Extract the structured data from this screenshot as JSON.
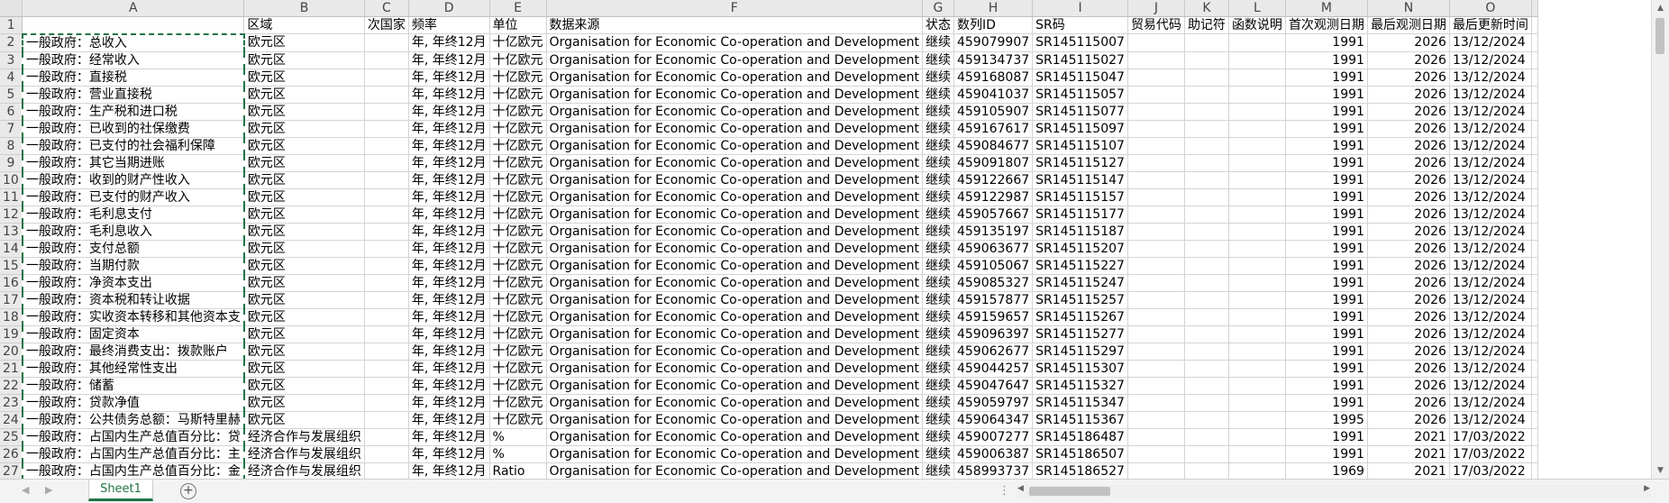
{
  "columns": [
    "A",
    "B",
    "C",
    "D",
    "E",
    "F",
    "G",
    "H",
    "I",
    "J",
    "K",
    "L",
    "M",
    "N",
    "O"
  ],
  "headers": [
    "",
    "区域",
    "次国家",
    "频率",
    "单位",
    "数据来源",
    "状态",
    "数列ID",
    "SR码",
    "贸易代码",
    "助记符",
    "函数说明",
    "首次观测日期",
    "最后观测日期",
    "最后更新时间"
  ],
  "rows": [
    {
      "n": "2",
      "a": "一般政府：总收入",
      "b": "欧元区",
      "c": "",
      "d": "年, 年终12月",
      "e": "十亿欧元",
      "f": "Organisation for Economic Co-operation and Development",
      "g": "继续",
      "h": "459079907",
      "i": "SR145115007",
      "j": "",
      "k": "",
      "l": "",
      "m": "1991",
      "nn": "2026",
      "o": "13/12/2024"
    },
    {
      "n": "3",
      "a": "一般政府：经常收入",
      "b": "欧元区",
      "c": "",
      "d": "年, 年终12月",
      "e": "十亿欧元",
      "f": "Organisation for Economic Co-operation and Development",
      "g": "继续",
      "h": "459134737",
      "i": "SR145115027",
      "j": "",
      "k": "",
      "l": "",
      "m": "1991",
      "nn": "2026",
      "o": "13/12/2024"
    },
    {
      "n": "4",
      "a": "一般政府：直接税",
      "b": "欧元区",
      "c": "",
      "d": "年, 年终12月",
      "e": "十亿欧元",
      "f": "Organisation for Economic Co-operation and Development",
      "g": "继续",
      "h": "459168087",
      "i": "SR145115047",
      "j": "",
      "k": "",
      "l": "",
      "m": "1991",
      "nn": "2026",
      "o": "13/12/2024"
    },
    {
      "n": "5",
      "a": "一般政府：营业直接税",
      "b": "欧元区",
      "c": "",
      "d": "年, 年终12月",
      "e": "十亿欧元",
      "f": "Organisation for Economic Co-operation and Development",
      "g": "继续",
      "h": "459041037",
      "i": "SR145115057",
      "j": "",
      "k": "",
      "l": "",
      "m": "1991",
      "nn": "2026",
      "o": "13/12/2024"
    },
    {
      "n": "6",
      "a": "一般政府：生产税和进口税",
      "b": "欧元区",
      "c": "",
      "d": "年, 年终12月",
      "e": "十亿欧元",
      "f": "Organisation for Economic Co-operation and Development",
      "g": "继续",
      "h": "459105907",
      "i": "SR145115077",
      "j": "",
      "k": "",
      "l": "",
      "m": "1991",
      "nn": "2026",
      "o": "13/12/2024"
    },
    {
      "n": "7",
      "a": "一般政府：已收到的社保缴费",
      "b": "欧元区",
      "c": "",
      "d": "年, 年终12月",
      "e": "十亿欧元",
      "f": "Organisation for Economic Co-operation and Development",
      "g": "继续",
      "h": "459167617",
      "i": "SR145115097",
      "j": "",
      "k": "",
      "l": "",
      "m": "1991",
      "nn": "2026",
      "o": "13/12/2024"
    },
    {
      "n": "8",
      "a": "一般政府：已支付的社会福利保障",
      "b": "欧元区",
      "c": "",
      "d": "年, 年终12月",
      "e": "十亿欧元",
      "f": "Organisation for Economic Co-operation and Development",
      "g": "继续",
      "h": "459084677",
      "i": "SR145115107",
      "j": "",
      "k": "",
      "l": "",
      "m": "1991",
      "nn": "2026",
      "o": "13/12/2024"
    },
    {
      "n": "9",
      "a": "一般政府：其它当期进账",
      "b": "欧元区",
      "c": "",
      "d": "年, 年终12月",
      "e": "十亿欧元",
      "f": "Organisation for Economic Co-operation and Development",
      "g": "继续",
      "h": "459091807",
      "i": "SR145115127",
      "j": "",
      "k": "",
      "l": "",
      "m": "1991",
      "nn": "2026",
      "o": "13/12/2024"
    },
    {
      "n": "10",
      "a": "一般政府：收到的财产性收入",
      "b": "欧元区",
      "c": "",
      "d": "年, 年终12月",
      "e": "十亿欧元",
      "f": "Organisation for Economic Co-operation and Development",
      "g": "继续",
      "h": "459122667",
      "i": "SR145115147",
      "j": "",
      "k": "",
      "l": "",
      "m": "1991",
      "nn": "2026",
      "o": "13/12/2024"
    },
    {
      "n": "11",
      "a": "一般政府：已支付的财产收入",
      "b": "欧元区",
      "c": "",
      "d": "年, 年终12月",
      "e": "十亿欧元",
      "f": "Organisation for Economic Co-operation and Development",
      "g": "继续",
      "h": "459122987",
      "i": "SR145115157",
      "j": "",
      "k": "",
      "l": "",
      "m": "1991",
      "nn": "2026",
      "o": "13/12/2024"
    },
    {
      "n": "12",
      "a": "一般政府：毛利息支付",
      "b": "欧元区",
      "c": "",
      "d": "年, 年终12月",
      "e": "十亿欧元",
      "f": "Organisation for Economic Co-operation and Development",
      "g": "继续",
      "h": "459057667",
      "i": "SR145115177",
      "j": "",
      "k": "",
      "l": "",
      "m": "1991",
      "nn": "2026",
      "o": "13/12/2024"
    },
    {
      "n": "13",
      "a": "一般政府：毛利息收入",
      "b": "欧元区",
      "c": "",
      "d": "年, 年终12月",
      "e": "十亿欧元",
      "f": "Organisation for Economic Co-operation and Development",
      "g": "继续",
      "h": "459135197",
      "i": "SR145115187",
      "j": "",
      "k": "",
      "l": "",
      "m": "1991",
      "nn": "2026",
      "o": "13/12/2024"
    },
    {
      "n": "14",
      "a": "一般政府：支付总额",
      "b": "欧元区",
      "c": "",
      "d": "年, 年终12月",
      "e": "十亿欧元",
      "f": "Organisation for Economic Co-operation and Development",
      "g": "继续",
      "h": "459063677",
      "i": "SR145115207",
      "j": "",
      "k": "",
      "l": "",
      "m": "1991",
      "nn": "2026",
      "o": "13/12/2024"
    },
    {
      "n": "15",
      "a": "一般政府：当期付款",
      "b": "欧元区",
      "c": "",
      "d": "年, 年终12月",
      "e": "十亿欧元",
      "f": "Organisation for Economic Co-operation and Development",
      "g": "继续",
      "h": "459105067",
      "i": "SR145115227",
      "j": "",
      "k": "",
      "l": "",
      "m": "1991",
      "nn": "2026",
      "o": "13/12/2024"
    },
    {
      "n": "16",
      "a": "一般政府：净资本支出",
      "b": "欧元区",
      "c": "",
      "d": "年, 年终12月",
      "e": "十亿欧元",
      "f": "Organisation for Economic Co-operation and Development",
      "g": "继续",
      "h": "459085327",
      "i": "SR145115247",
      "j": "",
      "k": "",
      "l": "",
      "m": "1991",
      "nn": "2026",
      "o": "13/12/2024"
    },
    {
      "n": "17",
      "a": "一般政府：资本税和转让收据",
      "b": "欧元区",
      "c": "",
      "d": "年, 年终12月",
      "e": "十亿欧元",
      "f": "Organisation for Economic Co-operation and Development",
      "g": "继续",
      "h": "459157877",
      "i": "SR145115257",
      "j": "",
      "k": "",
      "l": "",
      "m": "1991",
      "nn": "2026",
      "o": "13/12/2024"
    },
    {
      "n": "18",
      "a": "一般政府：实收资本转移和其他资本支",
      "b": "欧元区",
      "c": "",
      "d": "年, 年终12月",
      "e": "十亿欧元",
      "f": "Organisation for Economic Co-operation and Development",
      "g": "继续",
      "h": "459159657",
      "i": "SR145115267",
      "j": "",
      "k": "",
      "l": "",
      "m": "1991",
      "nn": "2026",
      "o": "13/12/2024"
    },
    {
      "n": "19",
      "a": "一般政府：固定资本",
      "b": "欧元区",
      "c": "",
      "d": "年, 年终12月",
      "e": "十亿欧元",
      "f": "Organisation for Economic Co-operation and Development",
      "g": "继续",
      "h": "459096397",
      "i": "SR145115277",
      "j": "",
      "k": "",
      "l": "",
      "m": "1991",
      "nn": "2026",
      "o": "13/12/2024"
    },
    {
      "n": "20",
      "a": "一般政府：最终消费支出：拨款账户",
      "b": "欧元区",
      "c": "",
      "d": "年, 年终12月",
      "e": "十亿欧元",
      "f": "Organisation for Economic Co-operation and Development",
      "g": "继续",
      "h": "459062677",
      "i": "SR145115297",
      "j": "",
      "k": "",
      "l": "",
      "m": "1991",
      "nn": "2026",
      "o": "13/12/2024"
    },
    {
      "n": "21",
      "a": "一般政府：其他经常性支出",
      "b": "欧元区",
      "c": "",
      "d": "年, 年终12月",
      "e": "十亿欧元",
      "f": "Organisation for Economic Co-operation and Development",
      "g": "继续",
      "h": "459044257",
      "i": "SR145115307",
      "j": "",
      "k": "",
      "l": "",
      "m": "1991",
      "nn": "2026",
      "o": "13/12/2024"
    },
    {
      "n": "22",
      "a": "一般政府：储蓄",
      "b": "欧元区",
      "c": "",
      "d": "年, 年终12月",
      "e": "十亿欧元",
      "f": "Organisation for Economic Co-operation and Development",
      "g": "继续",
      "h": "459047647",
      "i": "SR145115327",
      "j": "",
      "k": "",
      "l": "",
      "m": "1991",
      "nn": "2026",
      "o": "13/12/2024"
    },
    {
      "n": "23",
      "a": "一般政府：贷款净值",
      "b": "欧元区",
      "c": "",
      "d": "年, 年终12月",
      "e": "十亿欧元",
      "f": "Organisation for Economic Co-operation and Development",
      "g": "继续",
      "h": "459059797",
      "i": "SR145115347",
      "j": "",
      "k": "",
      "l": "",
      "m": "1991",
      "nn": "2026",
      "o": "13/12/2024"
    },
    {
      "n": "24",
      "a": "一般政府：公共债务总额：马斯特里赫",
      "b": "欧元区",
      "c": "",
      "d": "年, 年终12月",
      "e": "十亿欧元",
      "f": "Organisation for Economic Co-operation and Development",
      "g": "继续",
      "h": "459064347",
      "i": "SR145115367",
      "j": "",
      "k": "",
      "l": "",
      "m": "1995",
      "nn": "2026",
      "o": "13/12/2024"
    },
    {
      "n": "25",
      "a": "一般政府：占国内生产总值百分比：贷",
      "b": "经济合作与发展组织",
      "c": "",
      "d": "年, 年终12月",
      "e": "%",
      "f": "Organisation for Economic Co-operation and Development",
      "g": "继续",
      "h": "459007277",
      "i": "SR145186487",
      "j": "",
      "k": "",
      "l": "",
      "m": "1991",
      "nn": "2021",
      "o": "17/03/2022"
    },
    {
      "n": "26",
      "a": "一般政府：占国内生产总值百分比：主",
      "b": "经济合作与发展组织",
      "c": "",
      "d": "年, 年终12月",
      "e": "%",
      "f": "Organisation for Economic Co-operation and Development",
      "g": "继续",
      "h": "459006387",
      "i": "SR145186507",
      "j": "",
      "k": "",
      "l": "",
      "m": "1991",
      "nn": "2021",
      "o": "17/03/2022"
    },
    {
      "n": "27",
      "a": "一般政府：占国内生产总值百分比：金",
      "b": "经济合作与发展组织",
      "c": "",
      "d": "年, 年终12月",
      "e": "Ratio",
      "f": "Organisation for Economic Co-operation and Development",
      "g": "继续",
      "h": "458993737",
      "i": "SR145186527",
      "j": "",
      "k": "",
      "l": "",
      "m": "1969",
      "nn": "2021",
      "o": "17/03/2022"
    }
  ],
  "header_row_label": "1",
  "sheet_tab": "Sheet1",
  "add_sheet_symbol": "+",
  "accent_color": "#217346"
}
